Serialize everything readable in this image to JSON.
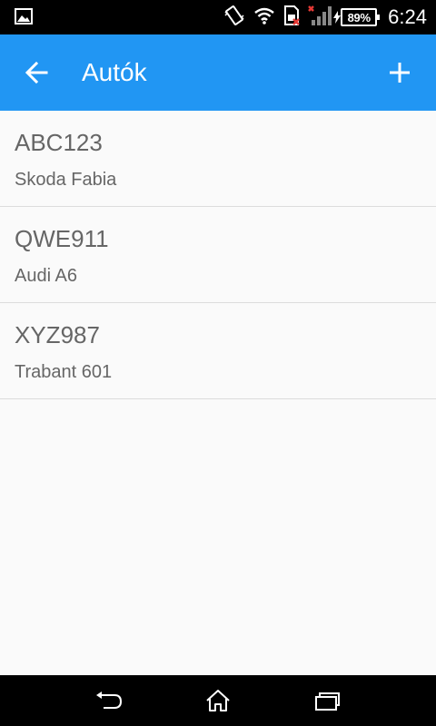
{
  "status_bar": {
    "battery": "89%",
    "time": "6:24",
    "icons": [
      "image-icon",
      "vibrate-icon",
      "wifi-icon",
      "sim-error-icon",
      "signal-icon",
      "battery-icon"
    ]
  },
  "app_bar": {
    "title": "Autók",
    "color": "#2196f3",
    "back_icon": "arrow-left-icon",
    "add_icon": "plus-icon"
  },
  "cars": [
    {
      "plate": "ABC123",
      "model": "Skoda Fabia"
    },
    {
      "plate": "QWE911",
      "model": "Audi A6"
    },
    {
      "plate": "XYZ987",
      "model": "Trabant 601"
    }
  ],
  "nav_bar": {
    "icons": [
      "back-icon",
      "home-icon",
      "recents-icon"
    ]
  }
}
